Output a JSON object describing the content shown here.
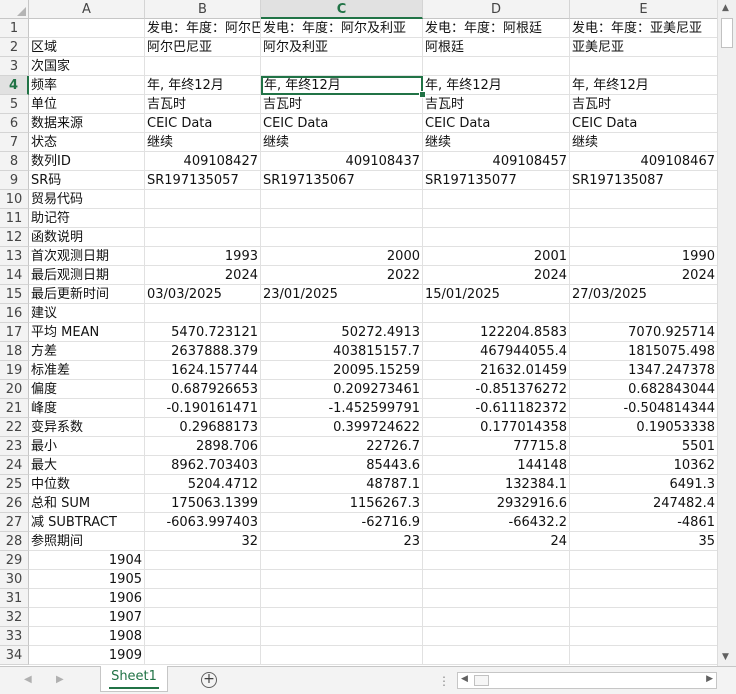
{
  "sheet_tab": "Sheet1",
  "selected_cell": "C4",
  "columns": [
    "A",
    "B",
    "C",
    "D",
    "E"
  ],
  "row_numbers": [
    "1",
    "2",
    "3",
    "4",
    "5",
    "6",
    "7",
    "8",
    "9",
    "10",
    "11",
    "12",
    "13",
    "14",
    "15",
    "16",
    "17",
    "18",
    "19",
    "20",
    "21",
    "22",
    "23",
    "24",
    "25",
    "26",
    "27",
    "28",
    "29",
    "30",
    "31",
    "32",
    "33",
    "34"
  ],
  "rows": [
    [
      "",
      "发电：年度：阿尔巴尼亚",
      "发电：年度：阿尔及利亚",
      "发电：年度：阿根廷",
      "发电：年度：亚美尼亚"
    ],
    [
      "区域",
      "阿尔巴尼亚",
      "阿尔及利亚",
      "阿根廷",
      "亚美尼亚"
    ],
    [
      "次国家",
      "",
      "",
      "",
      ""
    ],
    [
      "频率",
      "年, 年终12月",
      "年, 年终12月",
      "年, 年终12月",
      "年, 年终12月"
    ],
    [
      "单位",
      "吉瓦时",
      "吉瓦时",
      "吉瓦时",
      "吉瓦时"
    ],
    [
      "数据来源",
      "CEIC Data",
      "CEIC Data",
      "CEIC Data",
      "CEIC Data"
    ],
    [
      "状态",
      "继续",
      "继续",
      "继续",
      "继续"
    ],
    [
      "数列ID",
      "409108427",
      "409108437",
      "409108457",
      "409108467"
    ],
    [
      "SR码",
      "SR197135057",
      "SR197135067",
      "SR197135077",
      "SR197135087"
    ],
    [
      "贸易代码",
      "",
      "",
      "",
      ""
    ],
    [
      "助记符",
      "",
      "",
      "",
      ""
    ],
    [
      "函数说明",
      "",
      "",
      "",
      ""
    ],
    [
      "首次观测日期",
      "1993",
      "2000",
      "2001",
      "1990"
    ],
    [
      "最后观测日期",
      "2024",
      "2022",
      "2024",
      "2024"
    ],
    [
      "最后更新时间",
      "03/03/2025",
      "23/01/2025",
      "15/01/2025",
      "27/03/2025"
    ],
    [
      "建议",
      "",
      "",
      "",
      ""
    ],
    [
      "平均 MEAN",
      "5470.723121",
      "50272.4913",
      "122204.8583",
      "7070.925714"
    ],
    [
      "方差",
      "2637888.379",
      "403815157.7",
      "467944055.4",
      "1815075.498"
    ],
    [
      "标准差",
      "1624.157744",
      "20095.15259",
      "21632.01459",
      "1347.247378"
    ],
    [
      "偏度",
      "0.687926653",
      "0.209273461",
      "-0.851376272",
      "0.682843044"
    ],
    [
      "峰度",
      "-0.190161471",
      "-1.452599791",
      "-0.611182372",
      "-0.504814344"
    ],
    [
      "变异系数",
      "0.29688173",
      "0.399724622",
      "0.177014358",
      "0.19053338"
    ],
    [
      "最小",
      "2898.706",
      "22726.7",
      "77715.8",
      "5501"
    ],
    [
      "最大",
      "8962.703403",
      "85443.6",
      "144148",
      "10362"
    ],
    [
      "中位数",
      "5204.4712",
      "48787.1",
      "132384.1",
      "6491.3"
    ],
    [
      "总和 SUM",
      "175063.1399",
      "1156267.3",
      "2932916.6",
      "247482.4"
    ],
    [
      "减 SUBTRACT",
      "-6063.997403",
      "-62716.9",
      "-66432.2",
      "-4861"
    ],
    [
      "参照期间",
      "32",
      "23",
      "24",
      "35"
    ],
    [
      "1904",
      "",
      "",
      "",
      ""
    ],
    [
      "1905",
      "",
      "",
      "",
      ""
    ],
    [
      "1906",
      "",
      "",
      "",
      ""
    ],
    [
      "1907",
      "",
      "",
      "",
      ""
    ],
    [
      "1908",
      "",
      "",
      "",
      ""
    ],
    [
      "1909",
      "",
      "",
      "",
      ""
    ]
  ],
  "numeric_rows": [
    8,
    13,
    14,
    17,
    18,
    19,
    20,
    21,
    22,
    23,
    24,
    25,
    26,
    27,
    28
  ],
  "numeric_col_a_rows": [
    29,
    30,
    31,
    32,
    33,
    34
  ],
  "icons": {
    "vscroll_up": "scroll-up-arrow-icon",
    "vscroll_down": "scroll-down-arrow-icon",
    "hscroll_left": "scroll-left-arrow-icon",
    "hscroll_right": "scroll-right-arrow-icon",
    "add_sheet": "plus-circle-icon"
  },
  "colors": {
    "accent": "#217346",
    "header_bg": "#f3f3f3",
    "gridline": "#e1e1e1"
  }
}
